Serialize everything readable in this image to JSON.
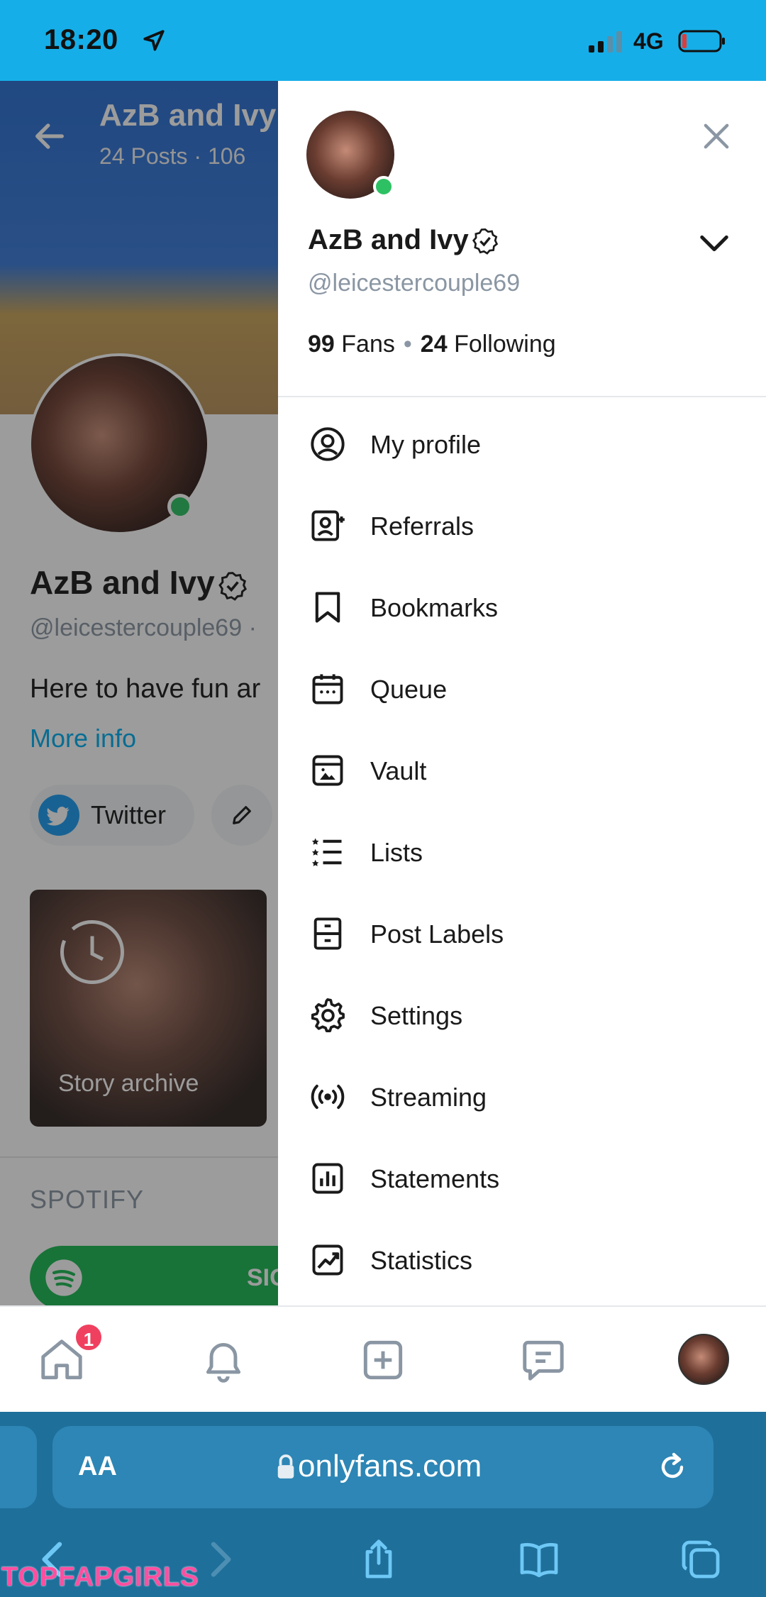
{
  "status_bar": {
    "time": "18:20",
    "network": "4G"
  },
  "background_profile": {
    "title": "AzB and Ivy",
    "subtitle": "24 Posts  ·  106",
    "name": "AzB and Ivy",
    "handle": "@leicestercouple69  ·",
    "bio": "Here to have fun ar",
    "more_info": "More info",
    "twitter_label": "Twitter",
    "story_label": "Story archive",
    "spotify_heading": "SPOTIFY",
    "spotify_button": "SIG"
  },
  "drawer": {
    "name": "AzB and Ivy",
    "handle": "@leicestercouple69",
    "fans_count": "99",
    "fans_label": "Fans",
    "following_count": "24",
    "following_label": "Following",
    "menu": [
      {
        "label": "My profile",
        "icon": "user-circle-icon"
      },
      {
        "label": "Referrals",
        "icon": "referrals-icon"
      },
      {
        "label": "Bookmarks",
        "icon": "bookmark-icon"
      },
      {
        "label": "Queue",
        "icon": "calendar-icon"
      },
      {
        "label": "Vault",
        "icon": "vault-icon"
      },
      {
        "label": "Lists",
        "icon": "lists-icon"
      },
      {
        "label": "Post Labels",
        "icon": "post-labels-icon"
      },
      {
        "label": "Settings",
        "icon": "gear-icon"
      },
      {
        "label": "Streaming",
        "icon": "streaming-icon"
      },
      {
        "label": "Statements",
        "icon": "statements-icon"
      },
      {
        "label": "Statistics",
        "icon": "statistics-icon"
      }
    ]
  },
  "bottom_nav": {
    "home_badge": "1"
  },
  "browser": {
    "aa_label": "AA",
    "url": "onlyfans.com"
  },
  "watermark": "TOPFAPGIRLS",
  "colors": {
    "accent": "#00aff0",
    "status_bar": "#16aee8",
    "online": "#2ec163",
    "badge": "#f0405f",
    "safari": "#1e6f9a"
  }
}
